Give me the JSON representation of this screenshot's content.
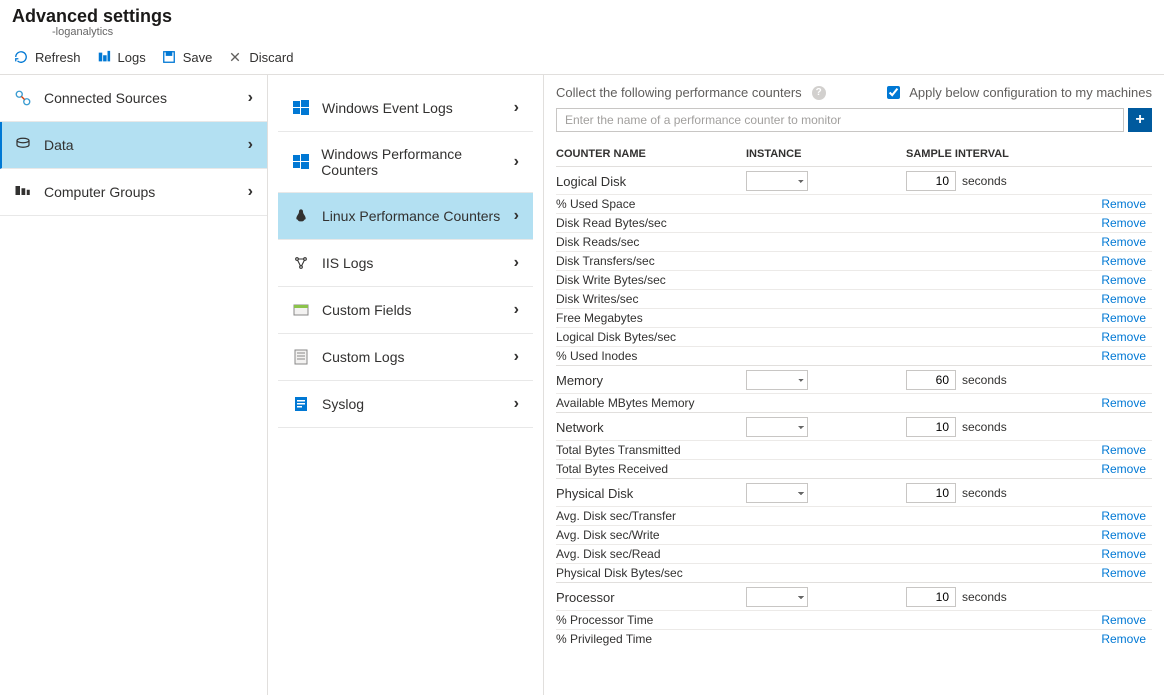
{
  "header": {
    "title": "Advanced settings",
    "subtitle": "-loganalytics"
  },
  "toolbar": {
    "refresh": "Refresh",
    "logs": "Logs",
    "save": "Save",
    "discard": "Discard"
  },
  "sidebar": {
    "items": [
      {
        "label": "Connected Sources"
      },
      {
        "label": "Data"
      },
      {
        "label": "Computer Groups"
      }
    ]
  },
  "data_menu": {
    "items": [
      {
        "label": "Windows Event Logs"
      },
      {
        "label": "Windows Performance Counters"
      },
      {
        "label": "Linux Performance Counters"
      },
      {
        "label": "IIS Logs"
      },
      {
        "label": "Custom Fields"
      },
      {
        "label": "Custom Logs"
      },
      {
        "label": "Syslog"
      }
    ]
  },
  "panel": {
    "collect_label": "Collect the following performance counters",
    "apply_label": "Apply below configuration to my machines",
    "apply_checked": true,
    "search_placeholder": "Enter the name of a performance counter to monitor",
    "headers": {
      "name": "COUNTER NAME",
      "instance": "INSTANCE",
      "interval": "SAMPLE INTERVAL"
    },
    "seconds": "seconds",
    "remove": "Remove",
    "groups": [
      {
        "name": "Logical Disk",
        "interval": "10",
        "counters": [
          "% Used Space",
          "Disk Read Bytes/sec",
          "Disk Reads/sec",
          "Disk Transfers/sec",
          "Disk Write Bytes/sec",
          "Disk Writes/sec",
          "Free Megabytes",
          "Logical Disk Bytes/sec",
          "% Used Inodes"
        ]
      },
      {
        "name": "Memory",
        "interval": "60",
        "counters": [
          "Available MBytes Memory"
        ]
      },
      {
        "name": "Network",
        "interval": "10",
        "counters": [
          "Total Bytes Transmitted",
          "Total Bytes Received"
        ]
      },
      {
        "name": "Physical Disk",
        "interval": "10",
        "counters": [
          "Avg. Disk sec/Transfer",
          "Avg. Disk sec/Write",
          "Avg. Disk sec/Read",
          "Physical Disk Bytes/sec"
        ]
      },
      {
        "name": "Processor",
        "interval": "10",
        "counters": [
          "% Processor Time",
          "% Privileged Time"
        ]
      }
    ]
  }
}
